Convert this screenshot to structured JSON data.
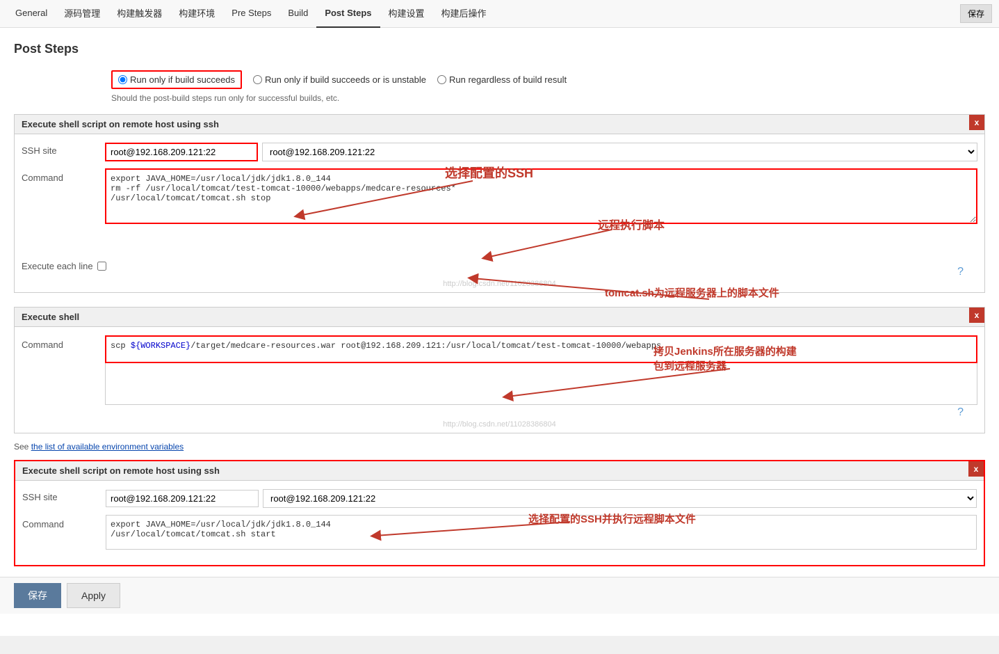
{
  "nav": {
    "items": [
      {
        "label": "General",
        "active": false
      },
      {
        "label": "源码管理",
        "active": false
      },
      {
        "label": "构建触发器",
        "active": false
      },
      {
        "label": "构建环境",
        "active": false
      },
      {
        "label": "Pre Steps",
        "active": false
      },
      {
        "label": "Build",
        "active": false
      },
      {
        "label": "Post Steps",
        "active": true
      },
      {
        "label": "构建设置",
        "active": false
      },
      {
        "label": "构建后操作",
        "active": false
      }
    ],
    "save_label": "保存"
  },
  "page": {
    "title": "Post Steps"
  },
  "radio": {
    "option1": "Run only if build succeeds",
    "option2": "Run only if build succeeds or is unstable",
    "option3": "Run regardless of build result",
    "hint": "Should the post-build steps run only for successful builds, etc."
  },
  "section1": {
    "title": "Execute shell script on remote host using ssh",
    "close": "x",
    "ssh_label": "SSH site",
    "ssh_value": "root@192.168.209.121:22",
    "command_label": "Command",
    "command_value": "export JAVA_HOME=/usr/local/jdk/jdk1.8.0_144\nrm -rf /usr/local/tomcat/test-tomcat-10000/webapps/medcare-resources*\n/usr/local/tomcat/tomcat.sh stop",
    "execute_each_line_label": "Execute each line",
    "watermark": "http://blog.csdn.net/11028386804"
  },
  "section2": {
    "title": "Execute shell",
    "close": "x",
    "command_label": "Command",
    "command_value": "scp ${WORKSPACE}/target/medcare-resources.war root@192.168.209.121:/usr/local/tomcat/test-tomcat-10000/webapps",
    "env_hint": "See the list of available environment variables"
  },
  "section3": {
    "title": "Execute shell script on remote host using ssh",
    "close": "x",
    "ssh_label": "SSH site",
    "ssh_value": "root@192.168.209.121:22",
    "command_label": "Command",
    "command_value": "export JAVA_HOME=/usr/local/jdk/jdk1.8.0_144\n/usr/local/tomcat/tomcat.sh start"
  },
  "annotations": {
    "ann1": "选择配置的SSH",
    "ann2": "远程执行脚本",
    "ann3": "tomcat.sh为远程服务器上的脚本文件",
    "ann4": "拷贝Jenkins所在服务器的构建\n包到远程服务器",
    "ann5": "选择配置的SSH并执行远程脚本文件"
  },
  "bottom": {
    "save_label": "保存",
    "apply_label": "Apply"
  }
}
